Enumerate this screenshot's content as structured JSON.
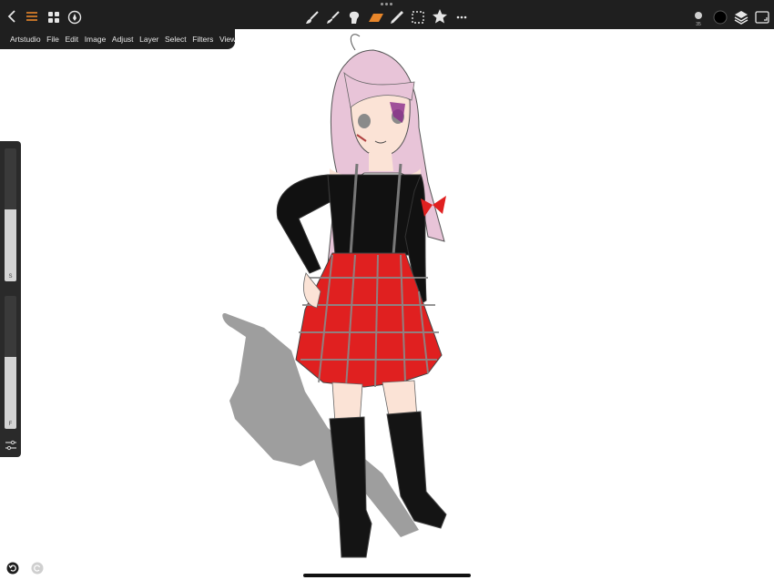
{
  "app": {
    "menu": [
      "Artstudio",
      "File",
      "Edit",
      "Image",
      "Adjust",
      "Layer",
      "Select",
      "Filters",
      "View"
    ]
  },
  "toolbar": {
    "left_icons": [
      "back-chevron-icon",
      "menu-lines-icon",
      "gallery-grid-icon",
      "pen-nib-icon"
    ],
    "tools": [
      "brush-icon",
      "smudge-icon",
      "blur-icon",
      "eraser-icon",
      "eyedropper-icon",
      "selection-icon",
      "favorites-star-icon",
      "more-icon"
    ],
    "right": {
      "brush_size": "35",
      "color": "#000000"
    },
    "active_tool": "eraser",
    "accent": "#e8862a"
  },
  "left_panel": {
    "size_label": "S",
    "flow_label": "F",
    "size_fill": 0.5,
    "flow_fill": 0.5
  },
  "bottom": {
    "undo": "undo-icon",
    "redo": "redo-icon"
  },
  "canvas": {
    "subject": "anime-girl-drawing"
  }
}
